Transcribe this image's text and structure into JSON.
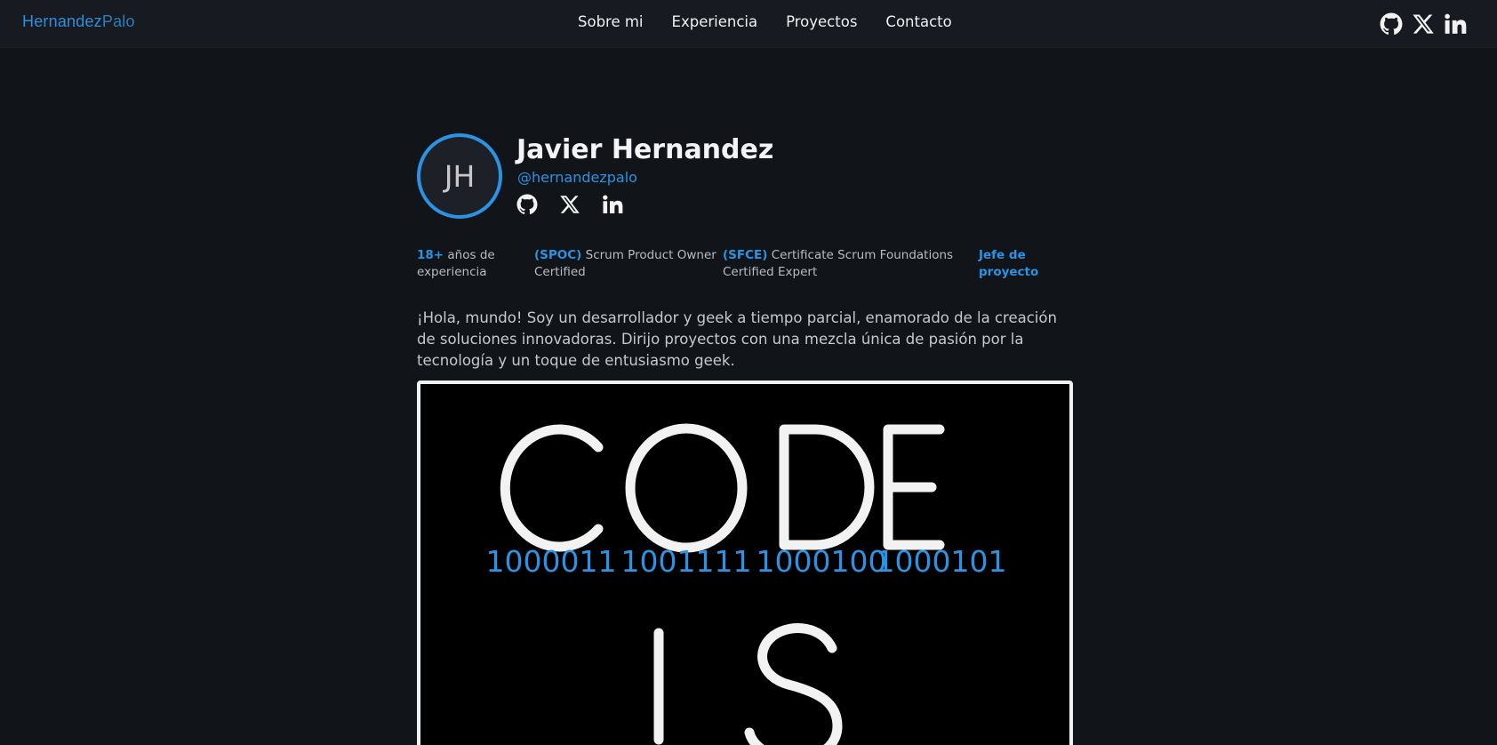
{
  "brand": {
    "part1": "Hernandez",
    "part2": "Palo"
  },
  "nav": {
    "items": [
      "Sobre mi",
      "Experiencia",
      "Proyectos",
      "Contacto"
    ]
  },
  "icons": {
    "github": "github-icon",
    "x": "x-twitter-icon",
    "linkedin": "linkedin-icon"
  },
  "profile": {
    "initials": "JH",
    "name": "Javier Hernandez",
    "handle": "@hernandezpalo"
  },
  "stats": [
    {
      "highlight": "18+",
      "text": " años de experiencia"
    },
    {
      "highlight": "(SPOC)",
      "text": " Scrum Product Owner Certified"
    },
    {
      "highlight": "(SFCE)",
      "text": " Certificate Scrum Foundations Certified Expert"
    },
    {
      "highlight": "",
      "text": "Jefe de proyecto"
    }
  ],
  "bio": "¡Hola, mundo! Soy un desarrollador y geek a tiempo parcial, enamorado de la creación de soluciones innovadoras. Dirijo proyectos con una mezcla única de pasión por la tecnología y un toque de entusiasmo geek.",
  "hero": {
    "word1": [
      "C",
      "O",
      "D",
      "E"
    ],
    "binary": [
      "1000011",
      "1001111",
      "1000100",
      "1000101"
    ],
    "word2": [
      "I",
      "S"
    ]
  },
  "colors": {
    "accent": "#2b93e3",
    "background": "#111419",
    "header": "#171b21"
  }
}
